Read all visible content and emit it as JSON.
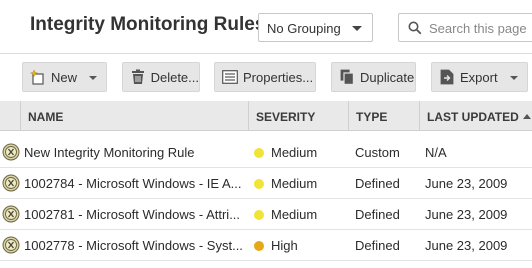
{
  "header": {
    "title": "Integrity Monitoring Rules",
    "grouping_value": "No Grouping",
    "search_placeholder": "Search this page"
  },
  "toolbar": {
    "new_label": "New",
    "delete_label": "Delete...",
    "properties_label": "Properties...",
    "duplicate_label": "Duplicate",
    "export_label": "Export"
  },
  "columns": {
    "name": "NAME",
    "severity": "SEVERITY",
    "type": "TYPE",
    "last_updated": "LAST UPDATED"
  },
  "rows": [
    {
      "name": "New Integrity Monitoring Rule",
      "severity": "Medium",
      "severity_color": "#f0e436",
      "type": "Custom",
      "last_updated": "N/A"
    },
    {
      "name": "1002784 - Microsoft Windows - IE A...",
      "severity": "Medium",
      "severity_color": "#f0e436",
      "type": "Defined",
      "last_updated": "June 23, 2009"
    },
    {
      "name": "1002781 - Microsoft Windows - Attri...",
      "severity": "Medium",
      "severity_color": "#f0e436",
      "type": "Defined",
      "last_updated": "June 23, 2009"
    },
    {
      "name": "1002778 - Microsoft Windows - Syst...",
      "severity": "High",
      "severity_color": "#e6a817",
      "type": "Defined",
      "last_updated": "June 23, 2009"
    }
  ]
}
